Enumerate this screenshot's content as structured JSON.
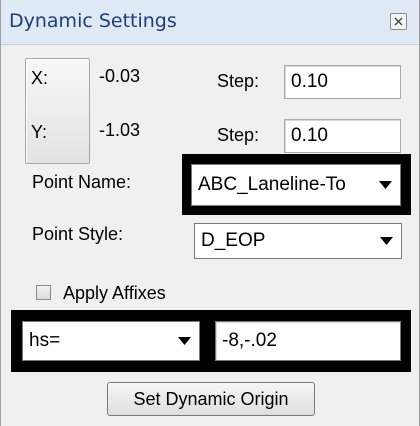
{
  "window": {
    "title": "Dynamic Settings",
    "close_icon": "close-icon"
  },
  "coords": {
    "x_label": "X:",
    "x_value": "-0.03",
    "y_label": "Y:",
    "y_value": "-1.03",
    "step_label": "Step:",
    "x_step": "0.10",
    "y_step": "0.10"
  },
  "point_name": {
    "label": "Point Name:",
    "value": "ABC_Laneline-To"
  },
  "point_style": {
    "label": "Point Style:",
    "value": "D_EOP"
  },
  "affixes": {
    "label": "Apply Affixes",
    "checked": false
  },
  "entry": {
    "mode": "hs=",
    "value": "-8,-.02"
  },
  "actions": {
    "set_origin_label": "Set Dynamic Origin"
  },
  "icons": {
    "dropdown": "chevron-down-icon"
  }
}
